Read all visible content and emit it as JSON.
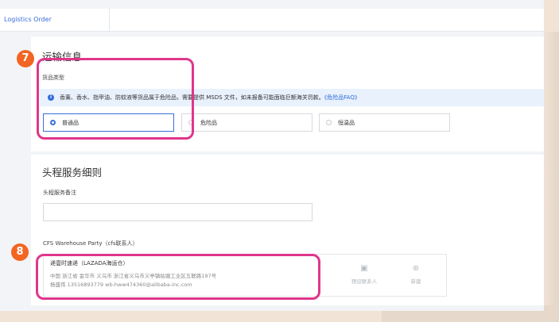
{
  "tab": {
    "title": "Logistics Order"
  },
  "shipping": {
    "title": "运输信息",
    "cargo_type_label": "货品类型",
    "notice": {
      "icon": "info-icon",
      "text": "香薰、香水、指甲油、防蚊液等货品属于危险品，需要提供 MSDS 文件，如未报备可能面临巨额海关罚款。",
      "link": "《危险品FAQ》"
    },
    "options": [
      {
        "label": "普通品",
        "selected": true
      },
      {
        "label": "危险品",
        "selected": false
      },
      {
        "label": "恒温品",
        "selected": false
      }
    ]
  },
  "head_service": {
    "title": "头程服务细则",
    "remarks_label": "头程服务备注",
    "remarks_value": "",
    "cfs_label": "CFS Warehouse Party（cfs联系人）",
    "party": {
      "name": "递壹时速递（LAZADA海运仓）",
      "address": "中国 浙江省 金华市 义乌市 浙江省义乌市义亭镇姑塘工业区五联路197号",
      "contact": "杨盛伟 13516893779 wb-hww474360@alibaba-inc.com"
    },
    "actions": [
      {
        "icon": "contact-card-icon",
        "label": "预设联系人"
      },
      {
        "icon": "plus-circle-icon",
        "label": "新建"
      }
    ]
  },
  "annotations": {
    "step7": "7",
    "step8": "8",
    "highlight_color": "#e0368c",
    "badge_color": "#f26522"
  }
}
